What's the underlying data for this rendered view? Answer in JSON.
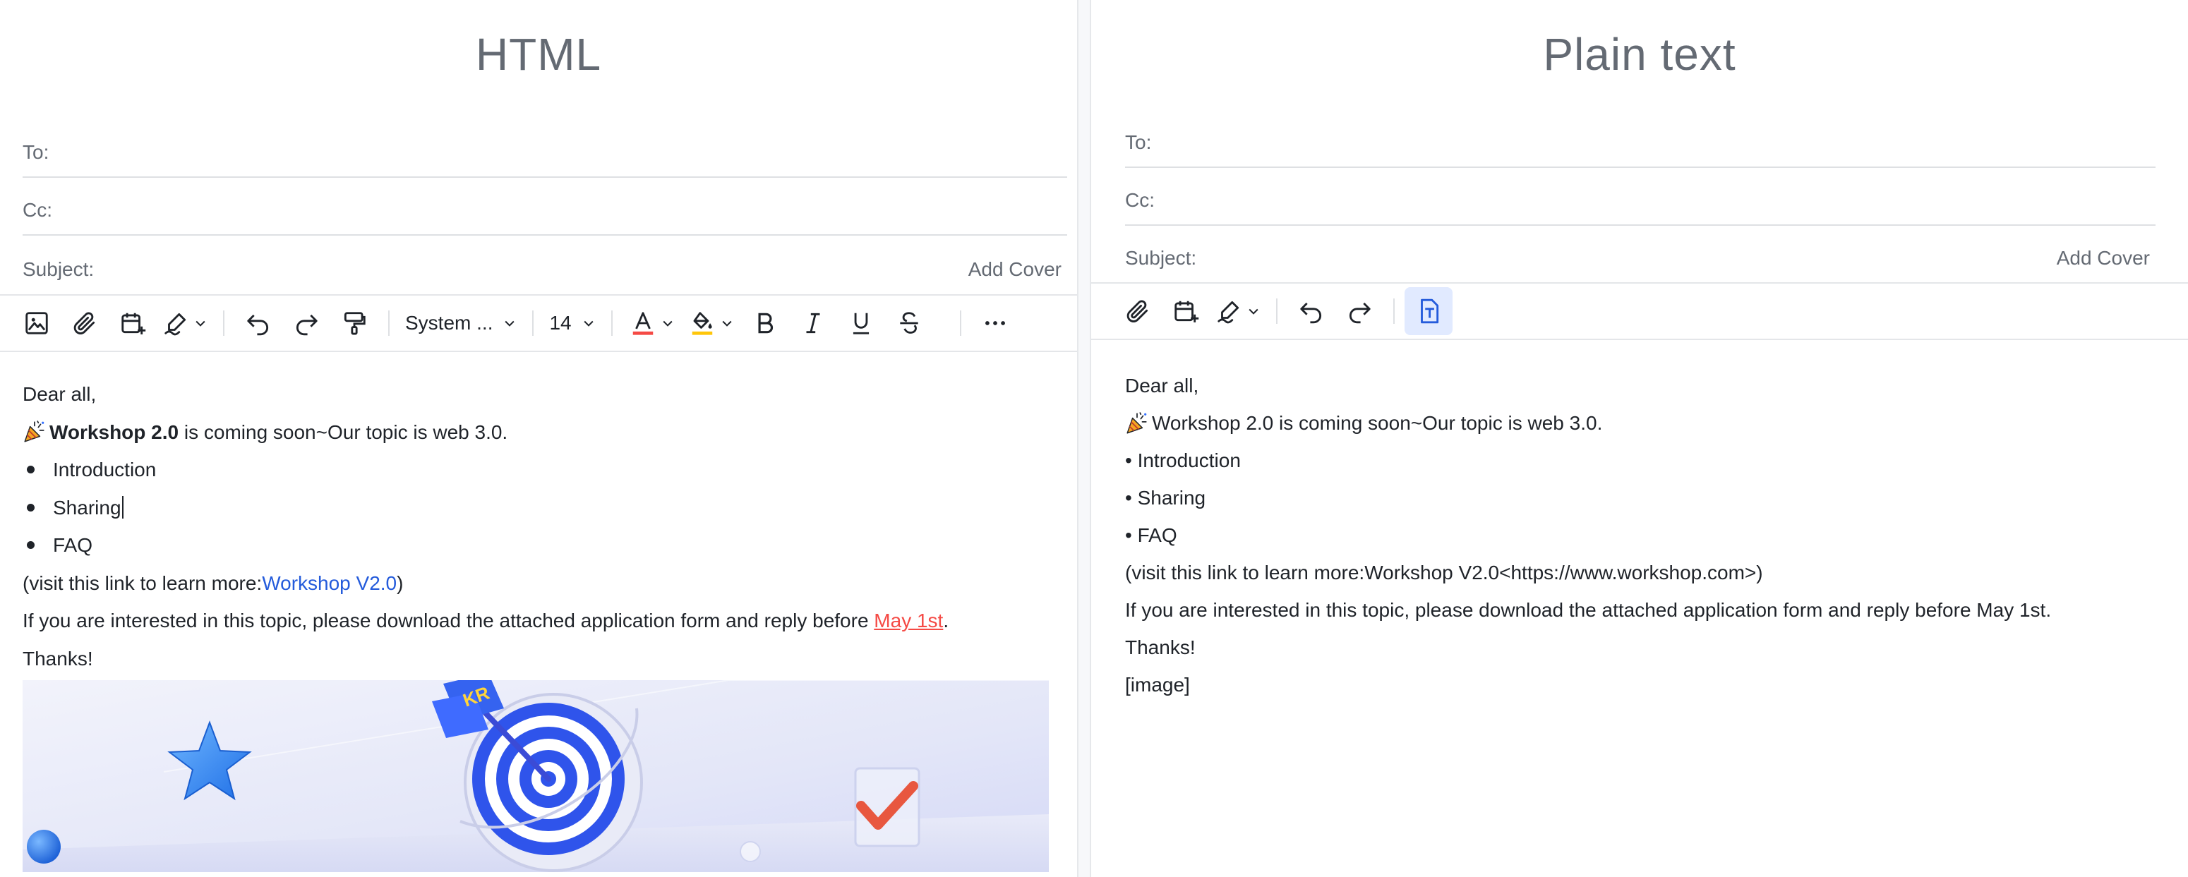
{
  "html_editor": {
    "title": "HTML",
    "to_label": "To:",
    "cc_label": "Cc:",
    "subject_label": "Subject:",
    "add_cover": "Add Cover",
    "toolbar": {
      "font_family": "System ...",
      "font_size": "14"
    },
    "body": {
      "greeting": "Dear all,",
      "line1_bold": "Workshop 2.0",
      "line1_rest": " is coming soon~Our topic is web 3.0.",
      "bullets": [
        "Introduction",
        "Sharing",
        "FAQ"
      ],
      "visit_prefix": "(visit this link to learn more:",
      "visit_link": "Workshop V2.0",
      "visit_suffix": ")",
      "interest_text": "If you are interested in this topic, please download the attached application form and reply before ",
      "interest_date": "May 1st",
      "interest_end": ".",
      "thanks": "Thanks!",
      "banner_badge": "KR"
    }
  },
  "plain_editor": {
    "title": "Plain text",
    "to_label": "To:",
    "cc_label": "Cc:",
    "subject_label": "Subject:",
    "add_cover": "Add Cover",
    "body": {
      "greeting": "Dear all,",
      "line1": "Workshop 2.0 is coming soon~Our topic is web 3.0.",
      "bullets": [
        "• Introduction",
        "• Sharing",
        "• FAQ"
      ],
      "visit": "(visit this link to learn more:Workshop V2.0<https://www.workshop.com>)",
      "interest": "If you are interested in this topic, please download the attached application form and reply before May 1st.",
      "thanks": "Thanks!",
      "image_placeholder": "[image]"
    }
  },
  "colors": {
    "accent_blue": "#245bdb",
    "link_red": "#f54a45",
    "text_color_bar": "#f54a45",
    "highlight_bar": "#ffc60a",
    "active_bg": "#e1eaff"
  }
}
